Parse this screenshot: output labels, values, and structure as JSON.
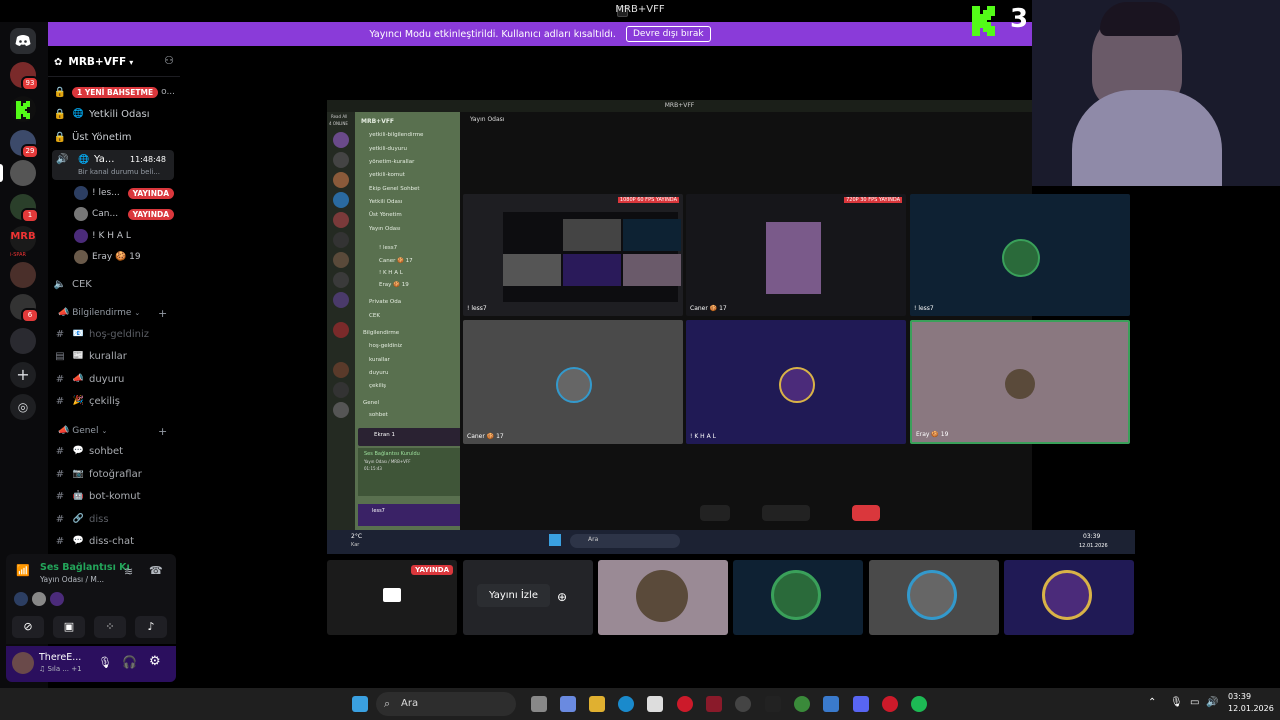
{
  "window": {
    "title": "MRB+VFF"
  },
  "banner": {
    "text": "Yayıncı Modu etkinleştirildi. Kullanıcı adları kısaltıldı.",
    "button": "Devre dışı bırak"
  },
  "overlay_logo": {
    "letter": "K",
    "number": "3"
  },
  "guilds": [
    {
      "badge": "93"
    },
    {
      "badge": ""
    },
    {
      "badge": "29"
    },
    {
      "badge": ""
    },
    {
      "badge": "1"
    },
    {
      "badge": ""
    },
    {
      "label": "i-SPAR",
      "badge": ""
    },
    {
      "badge": ""
    },
    {
      "badge": "6"
    },
    {
      "badge": ""
    }
  ],
  "sidebar": {
    "server_name": "MRB+VFF",
    "channels_top": [
      {
        "tag": "1 YENİ BAHSETME",
        "name": "o..."
      },
      {
        "name": "Yetkili Odası",
        "emoji": "🌐"
      },
      {
        "name": "Üst Yönetim"
      }
    ],
    "active_voice": {
      "name": "Ya...",
      "time": "11:48:48",
      "status": "Bir kanal durumu beli..."
    },
    "voice_users": [
      {
        "name": "! les...",
        "tag": "YAYINDA"
      },
      {
        "name": "Can...",
        "tag": "YAYINDA"
      },
      {
        "name": "! K H A L",
        "tag": ""
      },
      {
        "name": "Eray 🍪 19",
        "tag": ""
      }
    ],
    "cek": "CEK",
    "categories": [
      {
        "name": "Bilgilendirme",
        "channels": [
          {
            "name": "hoş-geldiniz",
            "emoji": "📧",
            "dim": true
          },
          {
            "name": "kurallar",
            "emoji": "📰"
          },
          {
            "name": "duyuru",
            "emoji": "📣"
          },
          {
            "name": "çekiliş",
            "emoji": "🎉"
          }
        ]
      },
      {
        "name": "Genel",
        "channels": [
          {
            "name": "sohbet",
            "emoji": "💬"
          },
          {
            "name": "fotoğraflar",
            "emoji": "📷"
          },
          {
            "name": "bot-komut",
            "emoji": "🤖"
          },
          {
            "name": "diss",
            "emoji": "🔗",
            "dim": true
          },
          {
            "name": "diss-chat",
            "emoji": "💬"
          }
        ]
      }
    ]
  },
  "voice_panel": {
    "title": "Ses Bağlantısı Kı",
    "subtitle": "Yayın Odası / M..."
  },
  "user_panel": {
    "name": "ThereE...",
    "status": "♫ Sıla ... +1"
  },
  "stream": {
    "title": "MRB+VFF",
    "channel": "Yayın Odası",
    "inner_server": "MRB+VFF",
    "inner_channels": [
      "yetkili-bilgilendirme",
      "yetkili-duyuru",
      "yönetim-kurallar",
      "yetkili-komut",
      "Ekip Genel Sohbet",
      "Yetkili Odası",
      "Üst Yönetim",
      "Yayın Odası",
      "! less7",
      "Caner 🍪 17",
      "! K H A L",
      "Eray 🍪 19",
      "Private Oda",
      "CEK",
      "Bilgilendirme",
      "hoş-geldiniz",
      "kurallar",
      "duyuru",
      "çekiliş",
      "Genel",
      "sohbet"
    ],
    "inner_online": "Read All",
    "inner_count": "4 ONLINE",
    "inner_screen": "Ekran 1",
    "inner_voice": "Ses Bağlantısı Kuruldu",
    "inner_voice_sub": "Yayın Odası / MRB+VFF",
    "inner_timer": "01:15:43",
    "inner_user": "less7",
    "tiles": [
      {
        "label": "! less7",
        "badge": "1080P 60 FPS  YAYINDA"
      },
      {
        "label": "Caner 🍪 17",
        "badge": "720P 30 FPS  YAYINDA"
      },
      {
        "label": "! less7",
        "badge": ""
      },
      {
        "label": "Caner 🍪 17",
        "badge": ""
      },
      {
        "label": "! K H A L",
        "badge": ""
      },
      {
        "label": "Eray 🍪 19",
        "badge": ""
      }
    ]
  },
  "inner_taskbar": {
    "weather": "2°C",
    "weather_sub": "Kar",
    "search": "Ara",
    "time": "03:39",
    "date": "12.01.2026"
  },
  "bottom_strip": {
    "live_tag": "YAYINDA",
    "watch_button": "Yayını İzle"
  },
  "taskbar": {
    "search": "Ara",
    "time": "03:39",
    "date": "12.01.2026"
  }
}
